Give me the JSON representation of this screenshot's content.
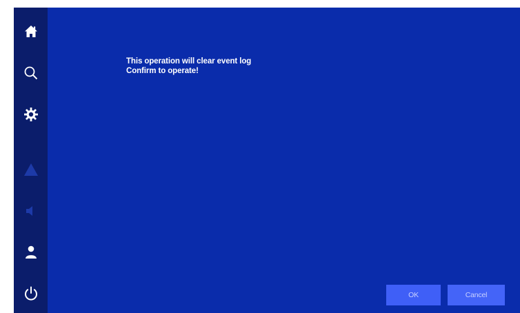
{
  "dialog": {
    "message_line1": "This operation will clear event log",
    "message_line2": "Confirm to operate!"
  },
  "buttons": {
    "ok_label": "OK",
    "cancel_label": "Cancel"
  },
  "sidebar": {
    "items": [
      {
        "icon": "home-icon"
      },
      {
        "icon": "search-icon"
      },
      {
        "icon": "settings-gear-icon"
      },
      {
        "icon": "warning-icon"
      },
      {
        "icon": "speaker-icon"
      },
      {
        "icon": "user-icon"
      },
      {
        "icon": "power-icon"
      }
    ]
  },
  "colors": {
    "background": "#0a2cab",
    "sidebar": "#0b1d6b",
    "button": "#3f5ff7",
    "text": "#ffffff",
    "disabled_icon": "#1d3aa8"
  }
}
